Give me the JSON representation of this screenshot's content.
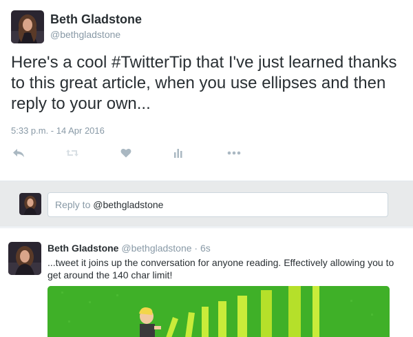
{
  "tweet": {
    "author_name": "Beth Gladstone",
    "author_handle": "@bethgladstone",
    "text": "Here's a cool #TwitterTip that I've just learned thanks to this great article, when you use ellipses and then reply to your own...",
    "timestamp": "5:33 p.m. - 14 Apr 2016",
    "actions": [
      {
        "icon": "reply-icon"
      },
      {
        "icon": "retweet-icon"
      },
      {
        "icon": "heart-icon"
      },
      {
        "icon": "analytics-icon"
      },
      {
        "icon": "more-icon"
      }
    ]
  },
  "reply_box": {
    "placeholder_prefix": "Reply to ",
    "mention": "@bethgladstone"
  },
  "reply_tweet": {
    "author_name": "Beth Gladstone",
    "meta": " @bethgladstone · 6s",
    "text": "...tweet it joins up the conversation for anyone reading. Effectively allowing you to get around the 140 char limit!",
    "media_icon": "domino-illustration"
  },
  "colors": {
    "text": "#292f33",
    "secondary": "#8899a6",
    "band": "#e8eaeb",
    "media_green": "#3fb028"
  }
}
